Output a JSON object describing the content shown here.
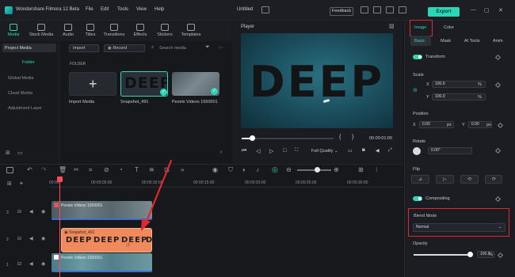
{
  "app": {
    "title": "Wondershare Filmora 12 Beta",
    "menu": [
      "File",
      "Edit",
      "Tools",
      "View",
      "Help"
    ],
    "project": "Untitled",
    "feedback": "Feedback",
    "export": "Export",
    "window_controls": [
      "—",
      "▢",
      "✕"
    ]
  },
  "media_tabs": [
    {
      "label": "Media",
      "icon": "media-icon"
    },
    {
      "label": "Stock Media",
      "icon": "stock-media-icon"
    },
    {
      "label": "Audio",
      "icon": "audio-icon"
    },
    {
      "label": "Titles",
      "icon": "titles-icon"
    },
    {
      "label": "Transitions",
      "icon": "transitions-icon"
    },
    {
      "label": "Effects",
      "icon": "effects-icon"
    },
    {
      "label": "Stickers",
      "icon": "stickers-icon"
    },
    {
      "label": "Templates",
      "icon": "templates-icon"
    }
  ],
  "sidebar": {
    "items": [
      "Project Media",
      "Folder",
      "Global Media",
      "Cloud Media",
      "Adjustment Layer"
    ]
  },
  "media": {
    "import_label": "Import",
    "record_label": "Record",
    "search_placeholder": "Search media",
    "folder_header": "FOLDER",
    "items": [
      {
        "label": "Import Media"
      },
      {
        "label": "Snapshot_491",
        "thumb_text": "DEEP"
      },
      {
        "label": "Pexels Videos 1550001"
      }
    ]
  },
  "player": {
    "label": "Player",
    "preview_text": "DEEP",
    "timecode": "00:00:01:00",
    "quality": "Full Quality",
    "brackets": [
      "{",
      "}"
    ]
  },
  "right_panel": {
    "tabs": [
      "Image",
      "Color"
    ],
    "subtabs": [
      "Basic",
      "Mask",
      "AI Tools",
      "Anim"
    ],
    "transform": "Transform",
    "scale": {
      "label": "Scale",
      "x_label": "X",
      "x": "100.0",
      "y_label": "Y",
      "y": "100.0",
      "unit": "%"
    },
    "position": {
      "label": "Position",
      "x_label": "X",
      "x": "0.00",
      "y_label": "Y",
      "y": "0.00",
      "unit": "px"
    },
    "rotate": {
      "label": "Rotate",
      "value": "0.00°"
    },
    "flip": "Flip",
    "compositing": "Compositing",
    "blend_mode": {
      "label": "Blend Mode",
      "value": "Normal"
    },
    "opacity": {
      "label": "Opacity",
      "value": "100.0",
      "unit": "%",
      "level": 1.0
    }
  },
  "timeline": {
    "ruler": [
      "00:00",
      "00:00:05:00",
      "00:00:10:00",
      "00:00:15:00",
      "00:00:20:00",
      "00:00:25:00",
      "00:00:30:00"
    ],
    "tracks": [
      {
        "index": "3",
        "clip": "Pexels Videos 1550001"
      },
      {
        "index": "2",
        "clip": "Snapshot_491",
        "clip_text": [
          "DEEP",
          "DEEP",
          "DEEP",
          "D"
        ]
      },
      {
        "index": "1",
        "clip": "Pexels Videos 1550001"
      }
    ]
  },
  "colors": {
    "accent": "#2ed8b6",
    "highlight": "#e0282d",
    "playhead": "#ff4a57",
    "image_clip": "#f08a5d"
  }
}
